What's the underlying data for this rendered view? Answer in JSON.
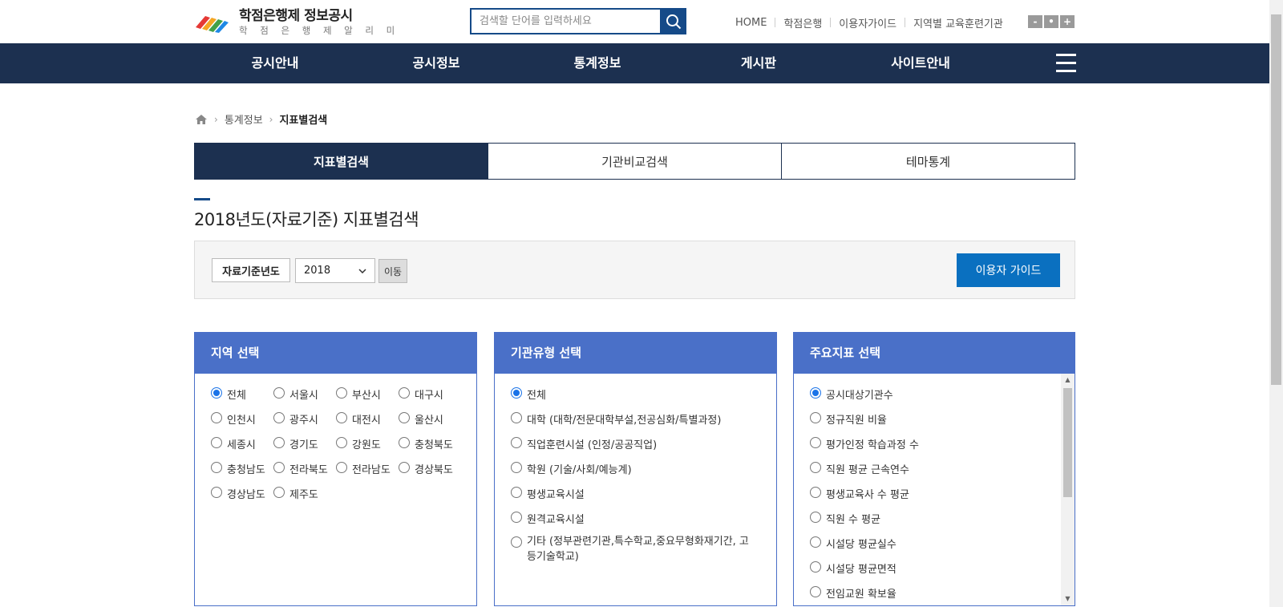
{
  "header": {
    "title": "학점은행제 정보공시",
    "subtitle": "학 점 은 행 제   알 리 미",
    "search_placeholder": "검색할 단어를 입력하세요",
    "top_links": [
      "HOME",
      "학점은행",
      "이용자가이드",
      "지역별 교육훈련기관"
    ],
    "zoom": [
      "-",
      "•",
      "+"
    ]
  },
  "nav": [
    "공시안내",
    "공시정보",
    "통계정보",
    "게시판",
    "사이트안내"
  ],
  "breadcrumb": [
    "통계정보",
    "지표별검색"
  ],
  "tabs": [
    "지표별검색",
    "기관비교검색",
    "테마통계"
  ],
  "page_title": "2018년도(자료기준) 지표별검색",
  "filter": {
    "label": "자료기준년도",
    "year": "2018",
    "go": "이동",
    "guide": "이용자 가이드"
  },
  "region": {
    "heading": "지역 선택",
    "options": [
      "전체",
      "서울시",
      "부산시",
      "대구시",
      "인천시",
      "광주시",
      "대전시",
      "울산시",
      "세종시",
      "경기도",
      "강원도",
      "충청북도",
      "충청남도",
      "전라북도",
      "전라남도",
      "경상북도",
      "경상남도",
      "제주도"
    ],
    "selected": "전체"
  },
  "inst_type": {
    "heading": "기관유형 선택",
    "options": [
      "전체",
      "대학 (대학/전문대학부설,전공심화/특별과정)",
      "직업훈련시설 (인정/공공직업)",
      "학원 (기술/사회/예능계)",
      "평생교육시설",
      "원격교육시설",
      "기타 (정부관련기관,특수학교,중요무형화재기간, 고등기술학교)"
    ],
    "selected": "전체"
  },
  "indicator": {
    "heading": "주요지표 선택",
    "options": [
      "공시대상기관수",
      "정규직원 비율",
      "평가인정 학습과정 수",
      "직원 평균 근속연수",
      "평생교육사 수 평균",
      "직원 수 평균",
      "시설당 평균실수",
      "시설당 평균면적",
      "전임교원 확보율"
    ],
    "selected": "공시대상기관수"
  },
  "colors": {
    "navy": "#1c3050",
    "panel_blue": "#4a70c8",
    "guide_blue": "#0a70c0"
  }
}
